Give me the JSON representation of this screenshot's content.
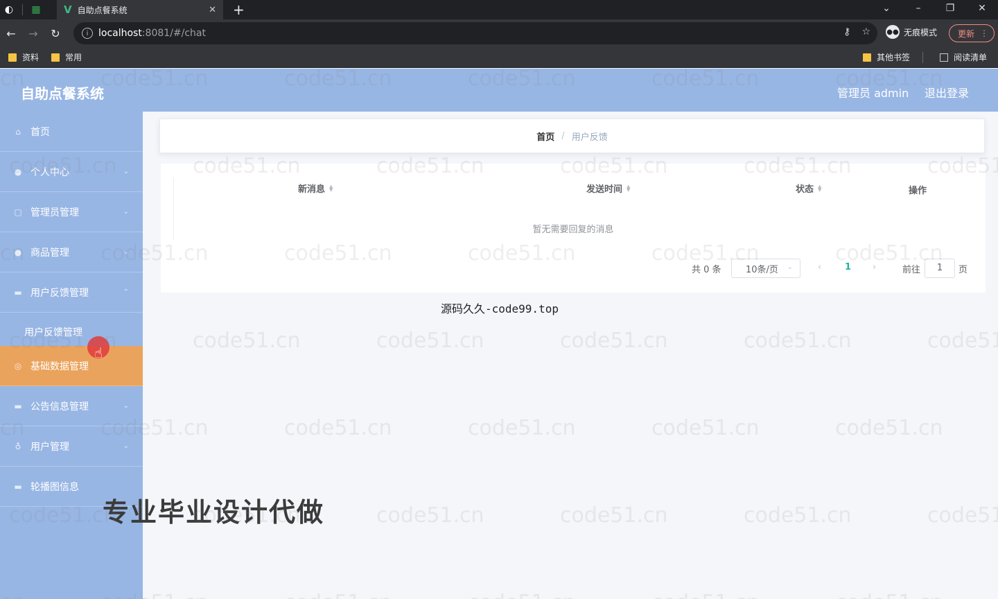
{
  "browser": {
    "tab_title": "自助点餐系统",
    "address_host": "localhost",
    "address_path": ":8081/#/chat",
    "incognito_label": "无痕模式",
    "update_label": "更新",
    "bookmarks": [
      "资料",
      "常用"
    ],
    "bookmarks_right": [
      "其他书签",
      "阅读清单"
    ]
  },
  "header": {
    "title": "自助点餐系统",
    "admin_label": "管理员 admin",
    "logout_label": "退出登录"
  },
  "sidebar": {
    "items": [
      {
        "label": "首页",
        "icon": "home-icon"
      },
      {
        "label": "个人中心",
        "icon": "user-icon"
      },
      {
        "label": "管理员管理",
        "icon": "admin-icon"
      },
      {
        "label": "商品管理",
        "icon": "goods-icon"
      },
      {
        "label": "用户反馈管理",
        "icon": "feedback-icon"
      },
      {
        "label": "基础数据管理",
        "icon": "data-icon"
      },
      {
        "label": "公告信息管理",
        "icon": "notice-icon"
      },
      {
        "label": "用户管理",
        "icon": "users-icon"
      },
      {
        "label": "轮播图信息",
        "icon": "carousel-icon"
      }
    ],
    "submenu": "用户反馈管理",
    "active_index": 5
  },
  "breadcrumb": {
    "home": "首页",
    "separator": "/",
    "current": "用户反馈"
  },
  "table": {
    "columns": [
      "新消息",
      "发送时间",
      "状态",
      "操作"
    ],
    "empty_text": "暂无需要回复的消息"
  },
  "pagination": {
    "total_text": "共 0 条",
    "page_size": "10条/页",
    "current_page": "1",
    "goto_label": "前往",
    "goto_value": "1",
    "page_unit": "页"
  },
  "overlays": {
    "code99": "源码久久-code99.top",
    "promo": "专业毕业设计代做",
    "watermark": "code51.cn"
  },
  "colors": {
    "header_bg": "#98b6e4",
    "active_item": "#eaa35c",
    "page_active": "#1fb5a0"
  }
}
